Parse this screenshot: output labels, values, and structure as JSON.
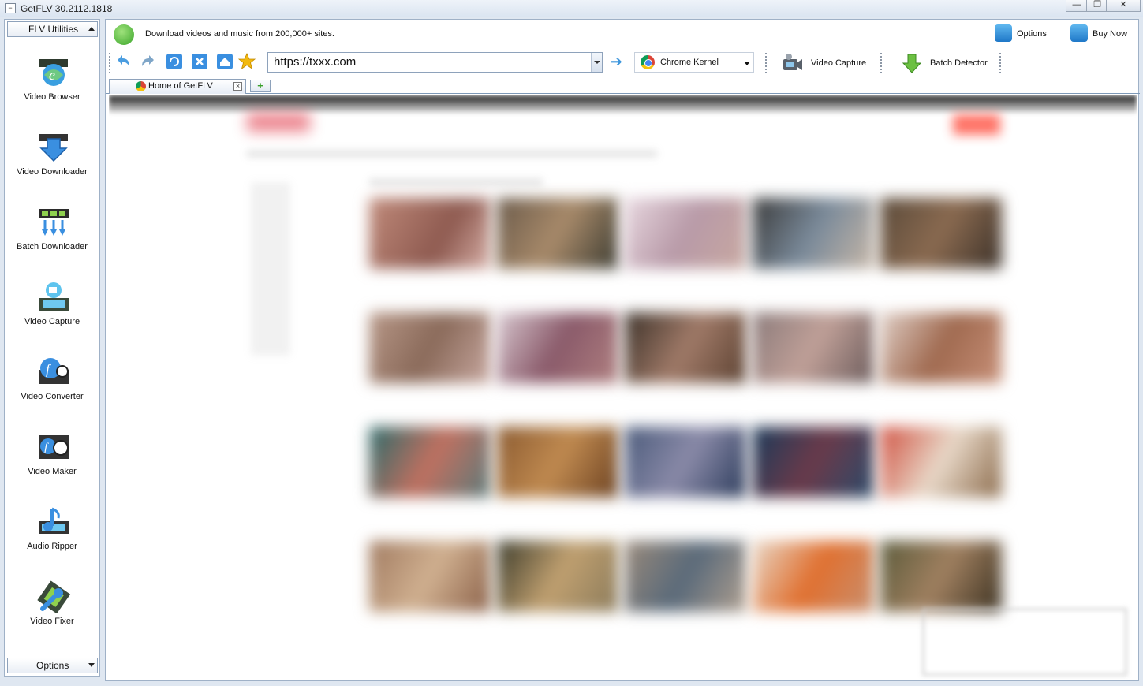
{
  "app": {
    "title": "GetFLV 30.2112.1818",
    "window_buttons": [
      "minimize",
      "restore",
      "close"
    ]
  },
  "sidebar": {
    "header_combo": "FLV Utilities",
    "footer_combo": "Options",
    "items": [
      {
        "label": "Video Browser",
        "icon": "globe-film-icon"
      },
      {
        "label": "Video Downloader",
        "icon": "download-arrow-icon"
      },
      {
        "label": "Batch Downloader",
        "icon": "film-arrows-icon"
      },
      {
        "label": "Video Capture",
        "icon": "camera-film-icon"
      },
      {
        "label": "Video Converter",
        "icon": "converter-icon"
      },
      {
        "label": "Video Maker",
        "icon": "film-reel-icon"
      },
      {
        "label": "Audio Ripper",
        "icon": "music-note-icon"
      },
      {
        "label": "Video Fixer",
        "icon": "wrench-film-icon"
      }
    ]
  },
  "header": {
    "notice": "Download videos and music from 200,000+ sites.",
    "options_label": "Options",
    "buy_label": "Buy Now"
  },
  "toolbar": {
    "url": "https://txxx.com",
    "kernel": "Chrome Kernel",
    "capture_label": "Video Capture",
    "batch_label": "Batch Detector"
  },
  "tabs": [
    {
      "label": "Home of GetFLV"
    }
  ],
  "colors": {
    "accent_blue": "#1f78c8",
    "frame_border": "#9fb1c7",
    "notice_green": "#3aa52a"
  }
}
